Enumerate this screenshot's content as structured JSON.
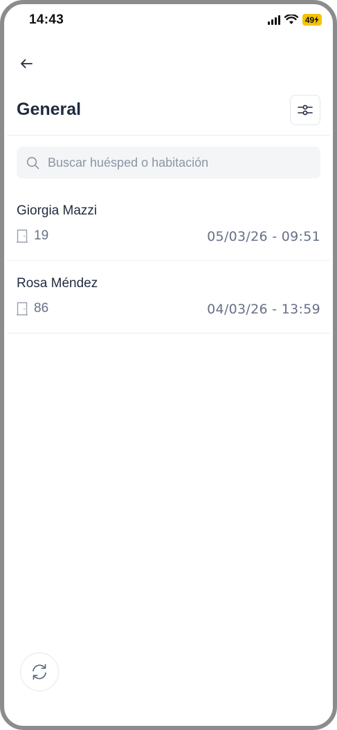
{
  "status_bar": {
    "time": "14:43",
    "battery": "49"
  },
  "header": {
    "title": "General"
  },
  "search": {
    "placeholder": "Buscar huésped o habitación"
  },
  "guests": [
    {
      "name": "Giorgia Mazzi",
      "room": "19",
      "datetime": "05/03/26 - 09:51"
    },
    {
      "name": "Rosa Méndez",
      "room": "86",
      "datetime": "04/03/26 - 13:59"
    }
  ],
  "icons": {
    "back": "arrow-left-icon",
    "filter": "sliders-icon",
    "search": "search-icon",
    "room": "door-icon",
    "refresh": "refresh-icon"
  },
  "colors": {
    "title": "#1f2a3d",
    "secondary_text": "#667085",
    "battery": "#f5c400"
  }
}
